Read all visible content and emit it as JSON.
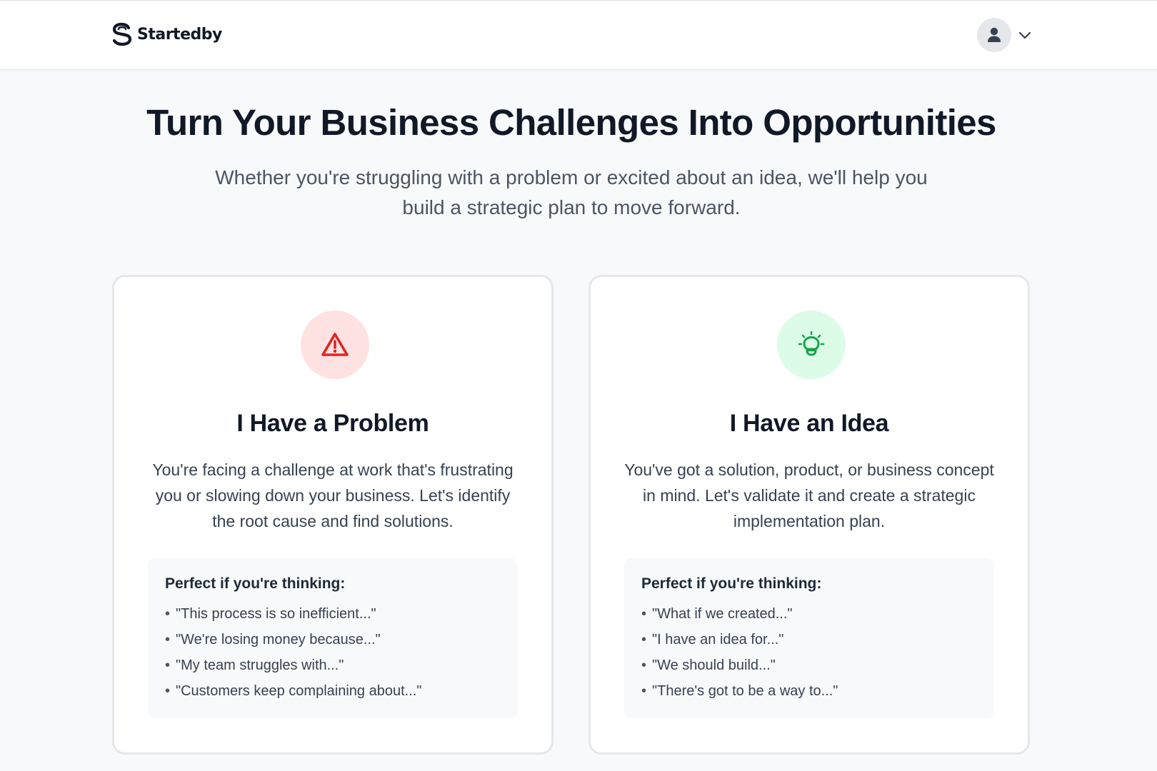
{
  "header": {
    "logo_text": "Startedby",
    "logo_icon": "s-logo-icon",
    "user_icon": "user-icon",
    "dropdown_icon": "chevron-down-icon"
  },
  "hero": {
    "title": "Turn Your Business Challenges Into Opportunities",
    "subtitle": "Whether you're struggling with a problem or excited about an idea, we'll help you build a strategic plan to move forward."
  },
  "cards": [
    {
      "icon": "warning-icon",
      "title": "I Have a Problem",
      "description": "You're facing a challenge at work that's frustrating you or slowing down your business. Let's identify the root cause and find solutions.",
      "examples_heading": "Perfect if you're thinking:",
      "examples": [
        "\"This process is so inefficient...\"",
        "\"We're losing money because...\"",
        "\"My team struggles with...\"",
        "\"Customers keep complaining about...\""
      ]
    },
    {
      "icon": "lightbulb-icon",
      "title": "I Have an Idea",
      "description": "You've got a solution, product, or business concept in mind. Let's validate it and create a strategic implementation plan.",
      "examples_heading": "Perfect if you're thinking:",
      "examples": [
        "\"What if we created...\"",
        "\"I have an idea for...\"",
        "\"We should build...\"",
        "\"There's got to be a way to...\""
      ]
    }
  ],
  "colors": {
    "problem_accent": "#dc2626",
    "problem_bg": "#fee2e2",
    "idea_accent": "#16a34a",
    "idea_bg": "#dcfce7"
  }
}
